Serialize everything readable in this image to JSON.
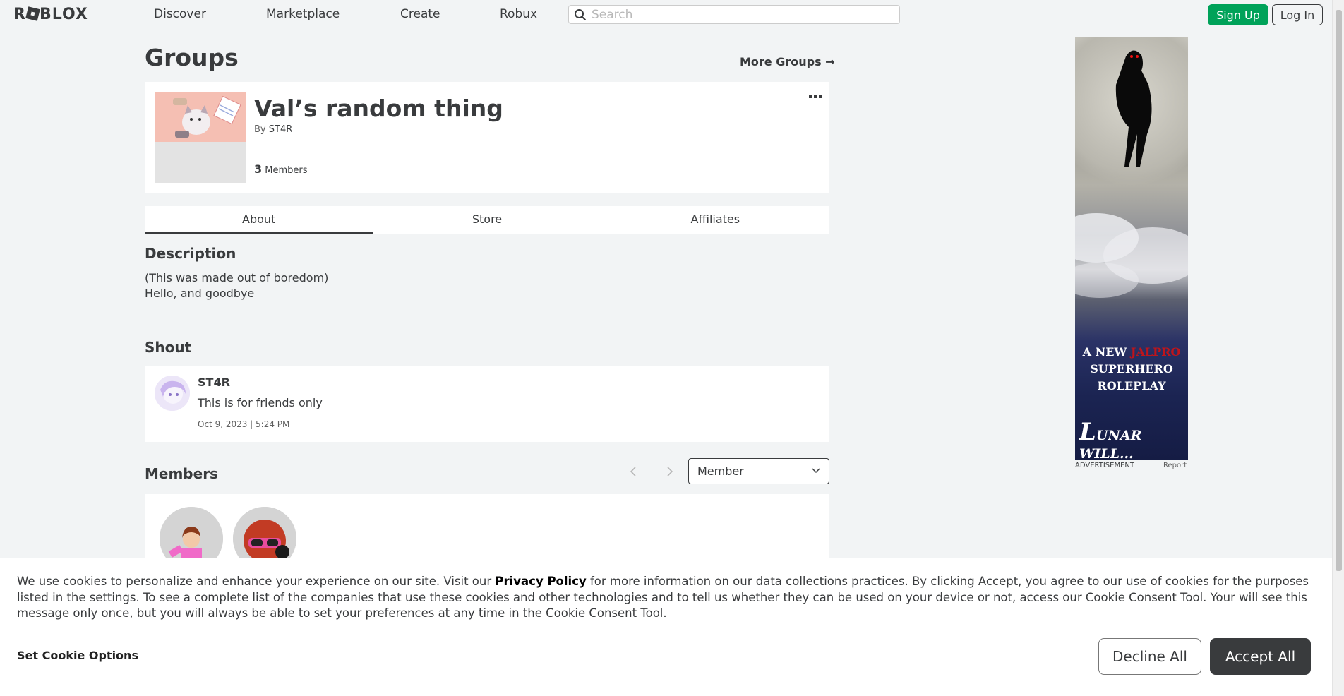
{
  "nav": {
    "logo": "ROBLOX",
    "links": [
      "Discover",
      "Marketplace",
      "Create",
      "Robux"
    ],
    "search_placeholder": "Search",
    "signup_label": "Sign Up",
    "login_label": "Log In"
  },
  "page": {
    "title": "Groups",
    "more_groups": "More Groups →"
  },
  "group": {
    "name": "Val’s random thing",
    "owner_prefix": "By",
    "owner": "ST4R",
    "member_count": "3",
    "member_label": "Members"
  },
  "tabs": [
    "About",
    "Store",
    "Affiliates"
  ],
  "active_tab": "About",
  "description": {
    "title": "Description",
    "lines": [
      "(This was made out of boredom)",
      "Hello, and goodbye"
    ]
  },
  "shout": {
    "title": "Shout",
    "user": "ST4R",
    "body": "This is for friends only",
    "date": "Oct 9, 2023 | 5:24 PM"
  },
  "members": {
    "title": "Members",
    "role_selected": "Member"
  },
  "ad": {
    "line1_prefix": "A NEW ",
    "line1_highlight": "JALPRO",
    "line2": "SUPERHERO",
    "line3": "ROLEPLAY",
    "brand_initial": "L",
    "brand_rest": "UNAR WILL...",
    "label": "ADVERTISEMENT",
    "report": "Report"
  },
  "cookie": {
    "text_before": "We use cookies to personalize and enhance your experience on our site. Visit our ",
    "link": "Privacy Policy",
    "text_after": " for more information on our data collections practices. By clicking Accept, you agree to our use of cookies for the purposes listed in the settings. To see a complete list of the companies that use these cookies and other technologies and to tell us whether they can be used on your device or not, access our Cookie Consent Tool. Your will see this message only once, but you will always be able to set your preferences at any time in the Cookie Consent Tool.",
    "options_label": "Set Cookie Options",
    "decline_label": "Decline All",
    "accept_label": "Accept All"
  },
  "colors": {
    "accent_green": "#00a259",
    "text_dark": "#393b3d",
    "background": "#f2f4f5"
  }
}
